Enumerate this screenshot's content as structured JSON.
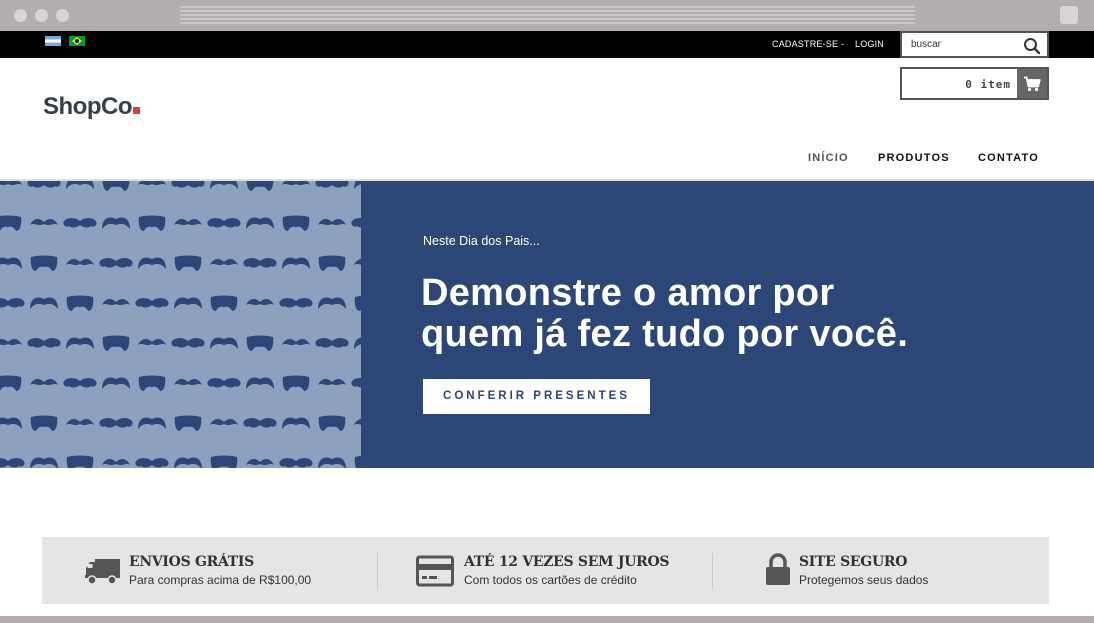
{
  "topbar": {
    "register_label": "CADASTRE-SE",
    "separator": "-",
    "login_label": "LOGIN",
    "search_placeholder": "buscar"
  },
  "header": {
    "logo_text": "ShopCo",
    "cart_label": "0 item"
  },
  "nav": {
    "items": [
      {
        "label": "INÍCIO",
        "active": true
      },
      {
        "label": "PRODUTOS",
        "active": false
      },
      {
        "label": "CONTATO",
        "active": false
      }
    ]
  },
  "hero": {
    "kicker": "Neste Dia dos Pais...",
    "title_line1": "Demonstre o amor por",
    "title_line2": "quem já fez tudo por você.",
    "button_label": "CONFERIR PRESENTES"
  },
  "features": [
    {
      "icon": "truck-icon",
      "title": "ENVIOS GRÁTIS",
      "subtitle": "Para compras acima de R$100,00"
    },
    {
      "icon": "credit-card-icon",
      "title": "ATÉ 12 VEZES SEM JUROS",
      "subtitle": "Com todos os cartões de crédito"
    },
    {
      "icon": "lock-icon",
      "title": "SITE SEGURO",
      "subtitle": "Protegemos seus dados"
    }
  ],
  "colors": {
    "hero_bg": "#2b4677",
    "pattern_bg": "#8da0bd",
    "logo_accent": "#e03c31",
    "feature_bg": "#e5e5e5"
  }
}
